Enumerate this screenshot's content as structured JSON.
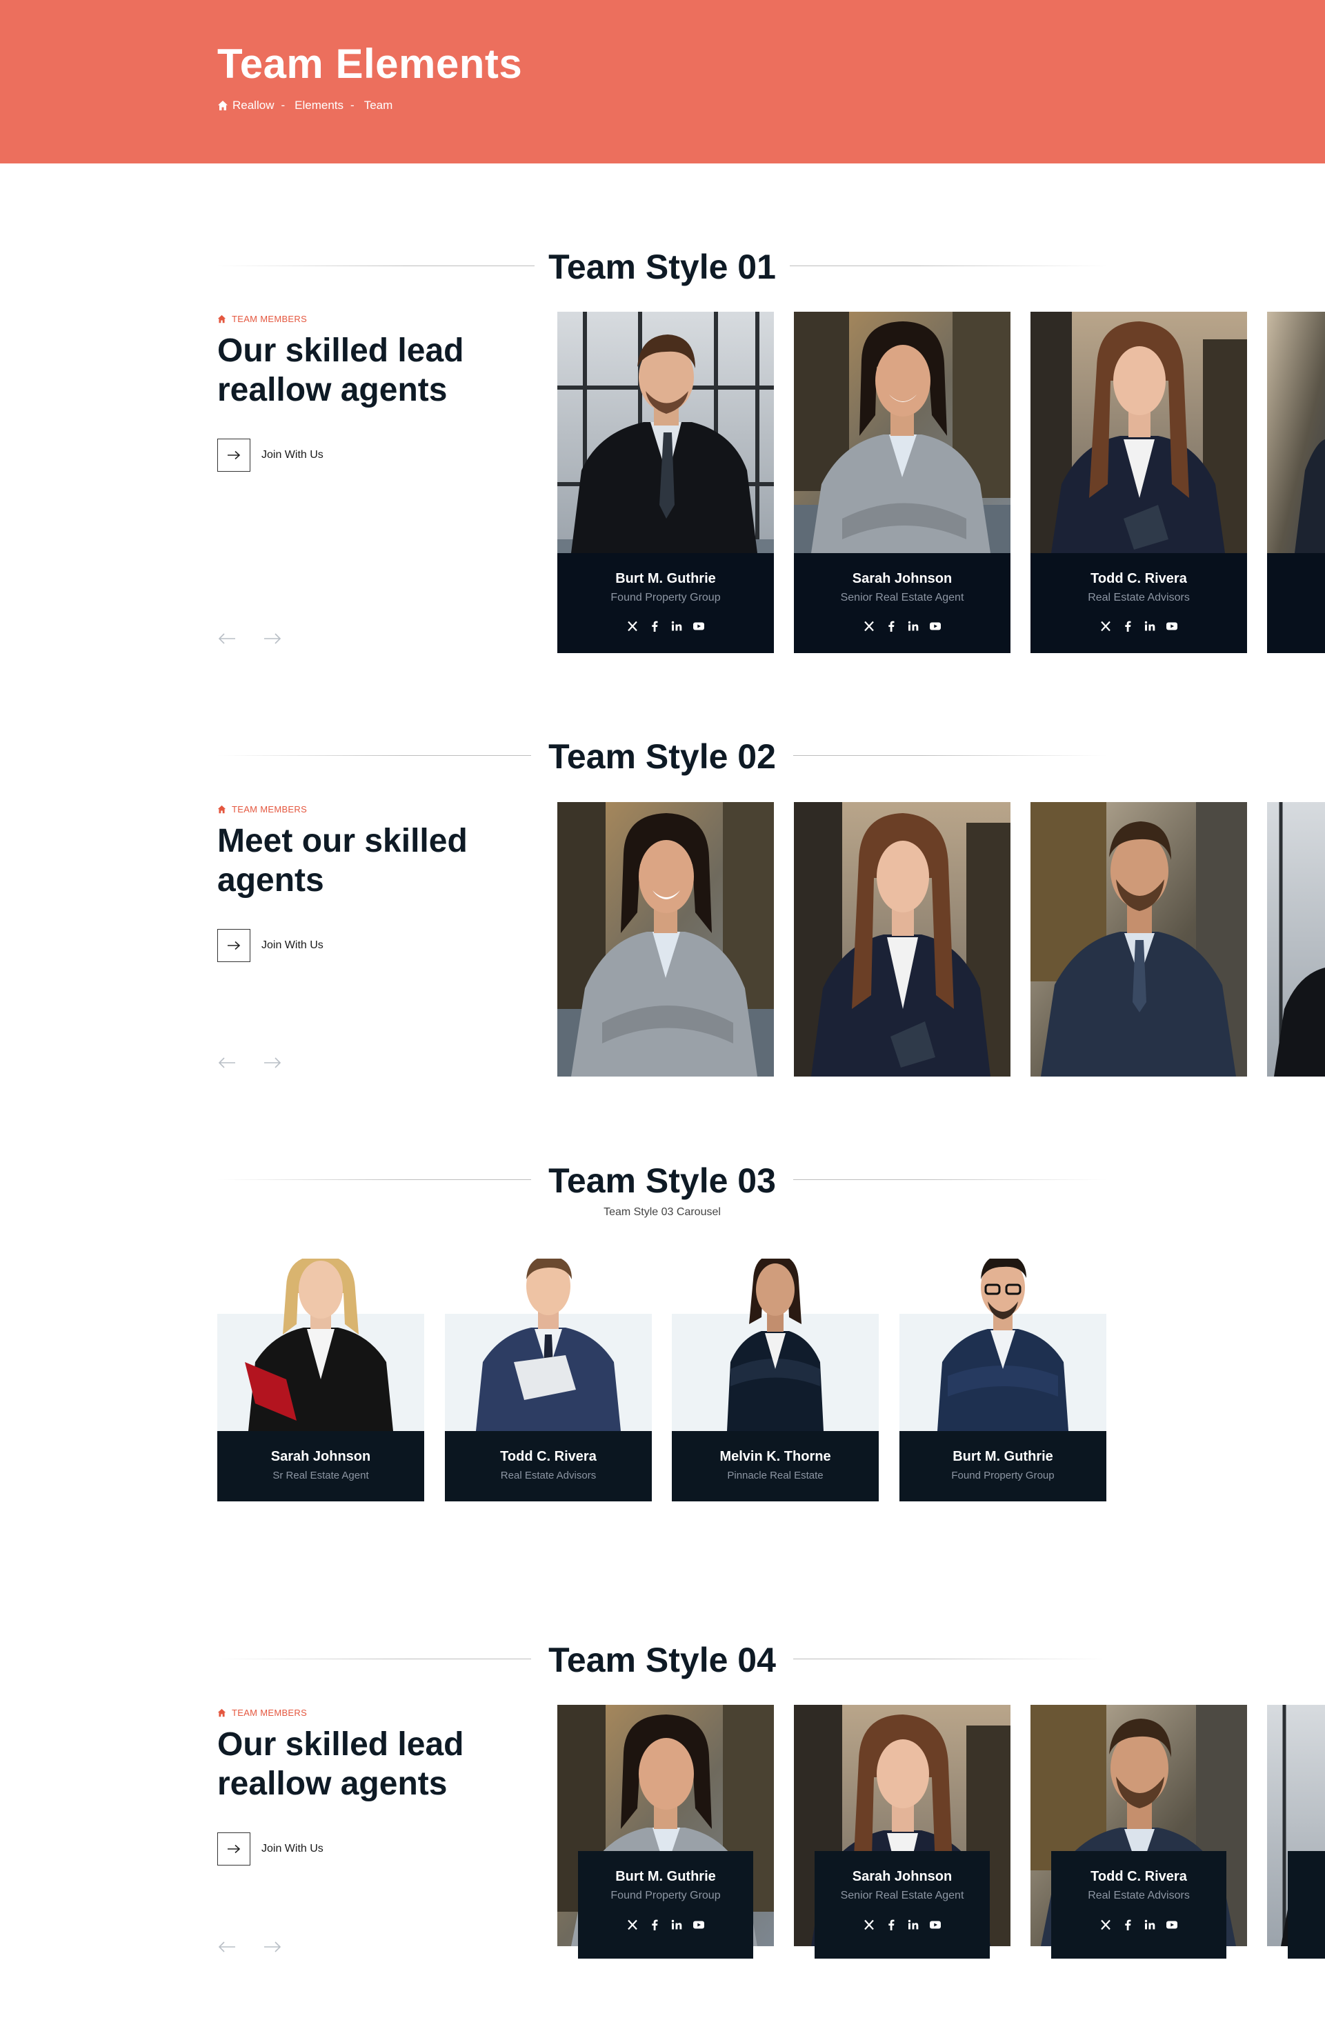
{
  "hero": {
    "title": "Team Elements",
    "breadcrumb": [
      "Reallow",
      "Elements",
      "Team"
    ],
    "separator": "-"
  },
  "section1": {
    "title": "Team Style 01",
    "kicker": "TEAM MEMBERS",
    "heading_line1": "Our skilled lead",
    "heading_line2": "reallow agents",
    "join_label": "Join With Us",
    "members": [
      {
        "name": "Burt M. Guthrie",
        "role": "Found Property Group"
      },
      {
        "name": "Sarah Johnson",
        "role": "Senior Real Estate Agent"
      },
      {
        "name": "Todd C. Rivera",
        "role": "Real Estate Advisors"
      }
    ]
  },
  "section2": {
    "title": "Team Style 02",
    "kicker": "TEAM MEMBERS",
    "heading_line1": "Meet our skilled",
    "heading_line2": "agents",
    "join_label": "Join With Us"
  },
  "section3": {
    "title": "Team Style 03",
    "subtitle": "Team Style 03 Carousel",
    "members": [
      {
        "name": "Sarah Johnson",
        "role": "Sr Real Estate Agent"
      },
      {
        "name": "Todd C. Rivera",
        "role": "Real Estate Advisors"
      },
      {
        "name": "Melvin K. Thorne",
        "role": "Pinnacle Real Estate"
      },
      {
        "name": "Burt M. Guthrie",
        "role": "Found Property Group"
      }
    ]
  },
  "section4": {
    "title": "Team Style 04",
    "kicker": "TEAM MEMBERS",
    "heading_line1": "Our skilled lead",
    "heading_line2": "reallow agents",
    "join_label": "Join With Us",
    "members": [
      {
        "name": "Burt M. Guthrie",
        "role": "Found Property Group"
      },
      {
        "name": "Sarah Johnson",
        "role": "Senior Real Estate Agent"
      },
      {
        "name": "Todd C. Rivera",
        "role": "Real Estate Advisors"
      }
    ]
  },
  "icons": {
    "home": "home-icon",
    "arrow": "arrow-right-icon",
    "socials": [
      "x-icon",
      "facebook-icon",
      "linkedin-icon",
      "youtube-icon"
    ]
  },
  "colors": {
    "accent": "#ec6f5d",
    "kicker": "#e4573f",
    "dark_card": "#07101c",
    "plate": "#0b1620",
    "heading": "#0e1a25"
  }
}
